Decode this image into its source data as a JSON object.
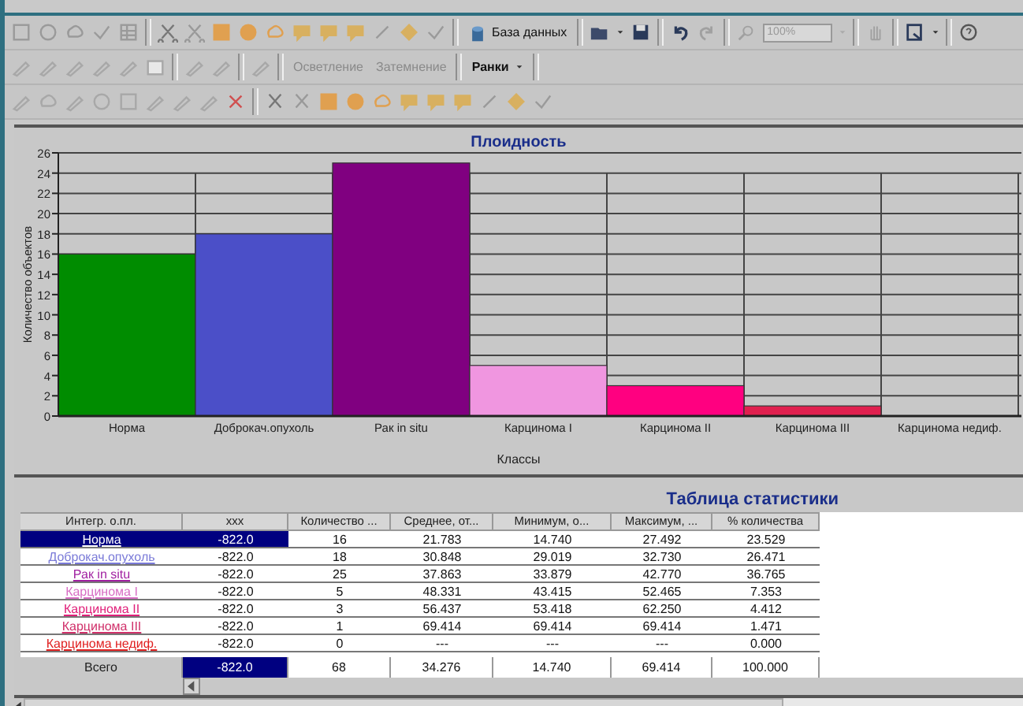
{
  "toolbar": {
    "database_button": "База данных",
    "zoom_field": {
      "value": "100%",
      "disabled": true
    },
    "lighten_button": {
      "label": "Осветление",
      "disabled": true
    },
    "darken_button": {
      "label": "Затемнение",
      "disabled": true
    },
    "frames_menu": "Ранки"
  },
  "chart": {
    "bars": [
      {
        "color": "#008c00"
      },
      {
        "color": "#4b4fc8"
      },
      {
        "color": "#800080"
      },
      {
        "color": "#f096e0"
      },
      {
        "color": "#ff0080"
      },
      {
        "color": "#e0204f"
      }
    ],
    "chart_data": {
      "type": "bar",
      "title": "Плоидность",
      "xlabel": "Классы",
      "ylabel": "Количество объектов",
      "categories": [
        "Норма",
        "Доброкач.опухоль",
        "Рак in situ",
        "Карцинома I",
        "Карцинома II",
        "Карцинома III",
        "Карцинома недиф."
      ],
      "values": [
        16,
        18,
        25,
        5,
        3,
        1,
        0
      ],
      "ylim": [
        0,
        26
      ],
      "yticks": [
        0,
        2,
        4,
        6,
        8,
        10,
        12,
        14,
        16,
        18,
        20,
        22,
        24,
        26
      ],
      "grid": true
    }
  },
  "table": {
    "title": "Таблица статистики",
    "columns": [
      "Интегр. о.пл.",
      "xxx",
      "Количество ...",
      "Среднее, от...",
      "Минимум, о...",
      "Максимум, ...",
      "% количества"
    ],
    "rows": [
      {
        "color": "#000080",
        "selected": true,
        "cells": [
          "Норма",
          "-822.0",
          "16",
          "21.783",
          "14.740",
          "27.492",
          "23.529"
        ]
      },
      {
        "color": "#7a7ad8",
        "selected": false,
        "cells": [
          "Доброкач.опухоль",
          "-822.0",
          "18",
          "30.848",
          "29.019",
          "32.730",
          "26.471"
        ]
      },
      {
        "color": "#a01fa0",
        "selected": false,
        "cells": [
          "Рак in situ",
          "-822.0",
          "25",
          "37.863",
          "33.879",
          "42.770",
          "36.765"
        ]
      },
      {
        "color": "#d86ec4",
        "selected": false,
        "cells": [
          "Карцинома I",
          "-822.0",
          "5",
          "48.331",
          "43.415",
          "52.465",
          "7.353"
        ]
      },
      {
        "color": "#e0207a",
        "selected": false,
        "cells": [
          "Карцинома II",
          "-822.0",
          "3",
          "56.437",
          "53.418",
          "62.250",
          "4.412"
        ]
      },
      {
        "color": "#d0306a",
        "selected": false,
        "cells": [
          "Карцинома III",
          "-822.0",
          "1",
          "69.414",
          "69.414",
          "69.414",
          "1.471"
        ]
      },
      {
        "color": "#e02020",
        "selected": false,
        "cells": [
          "Карцинома недиф.",
          "-822.0",
          "0",
          "---",
          "---",
          "---",
          "0.000"
        ]
      }
    ],
    "total": {
      "selected": true,
      "cells": [
        "Всего",
        "-822.0",
        "68",
        "34.276",
        "14.740",
        "69.414",
        "100.000"
      ]
    }
  }
}
